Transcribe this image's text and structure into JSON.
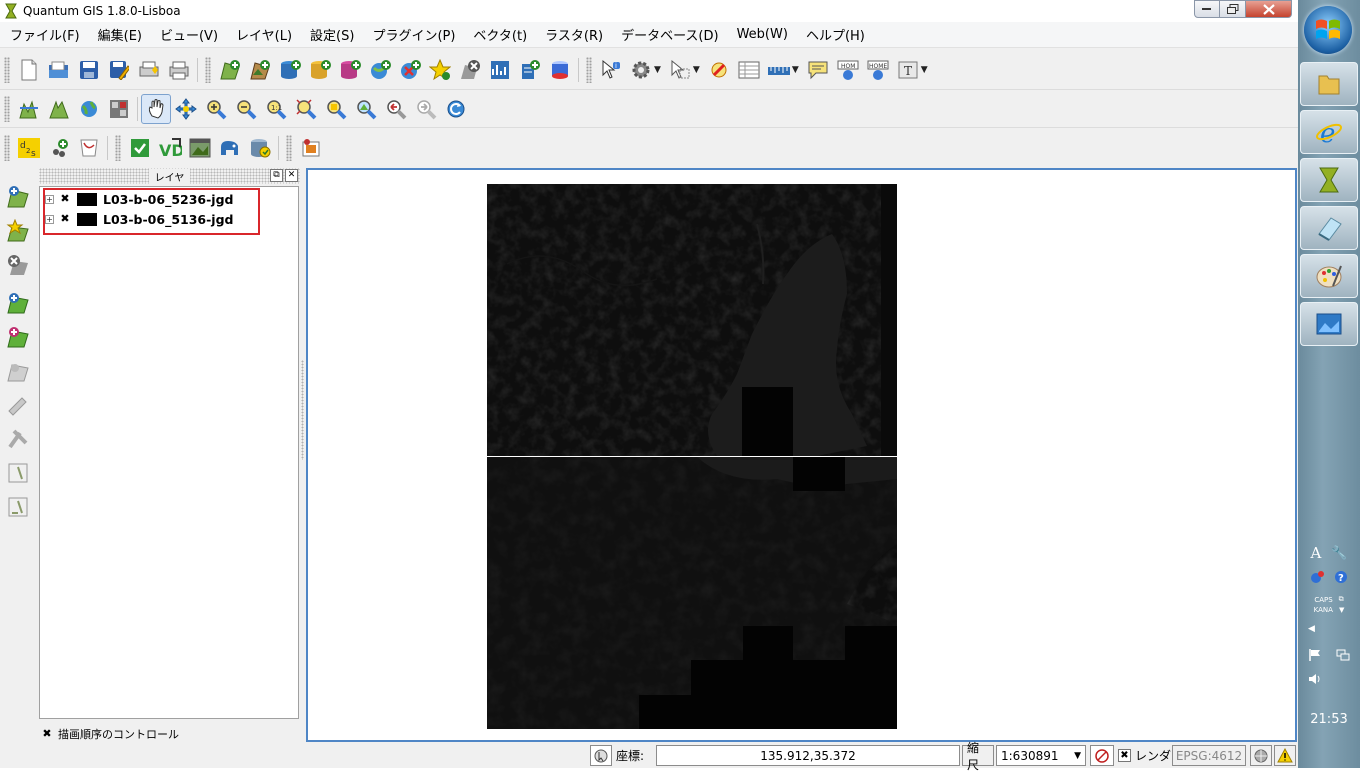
{
  "window": {
    "title": "Quantum GIS 1.8.0-Lisboa",
    "controls": [
      "minimize",
      "maximize",
      "close"
    ]
  },
  "menu": [
    "ファイル(F)",
    "編集(E)",
    "ビュー(V)",
    "レイヤ(L)",
    "設定(S)",
    "プラグイン(P)",
    "ベクタ(t)",
    "ラスタ(R)",
    "データベース(D)",
    "Web(W)",
    "ヘルプ(H)"
  ],
  "layer_panel": {
    "title": "レイヤ",
    "layers": [
      {
        "name": "L03-b-06_5236-jgd",
        "visible": "✖"
      },
      {
        "name": "L03-b-06_5136-jgd",
        "visible": "✖"
      }
    ],
    "draw_order_label": "描画順序のコントロール",
    "draw_order_checked": "✖"
  },
  "statusbar": {
    "coord_label": "座標:",
    "coord_value": "135.912,35.372",
    "scale_label": "縮尺",
    "scale_value": "1:630891",
    "render_label": "レンダ",
    "render_checked": "✖",
    "crs": "EPSG:4612"
  },
  "taskbar": {
    "clock": "21:53",
    "caps": "CAPS",
    "kana": "KANA"
  },
  "colors": {
    "map_border": "#4f86c6",
    "highlight_box": "#d9262b",
    "raster_fill": "#0e0e0e"
  }
}
